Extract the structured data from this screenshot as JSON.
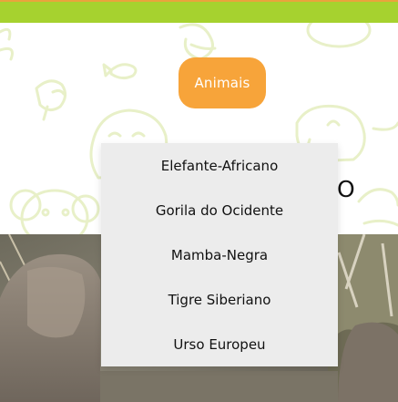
{
  "nav": {
    "button_label": "Animais"
  },
  "dropdown": {
    "items": [
      {
        "label": "Elefante-Africano"
      },
      {
        "label": "Gorila do Ocidente"
      },
      {
        "label": "Mamba-Negra"
      },
      {
        "label": "Tigre Siberiano"
      },
      {
        "label": "Urso Europeu"
      }
    ]
  },
  "hero": {
    "heading_fragment": "O",
    "image_subject": "elephant"
  },
  "colors": {
    "top_bar": "#a6d22f",
    "top_bar_border": "#e9a43d",
    "button": "#f7a43a",
    "button_text": "#ffffff",
    "pattern_line": "#e8f0c8",
    "dropdown_bg": "#ececec"
  }
}
